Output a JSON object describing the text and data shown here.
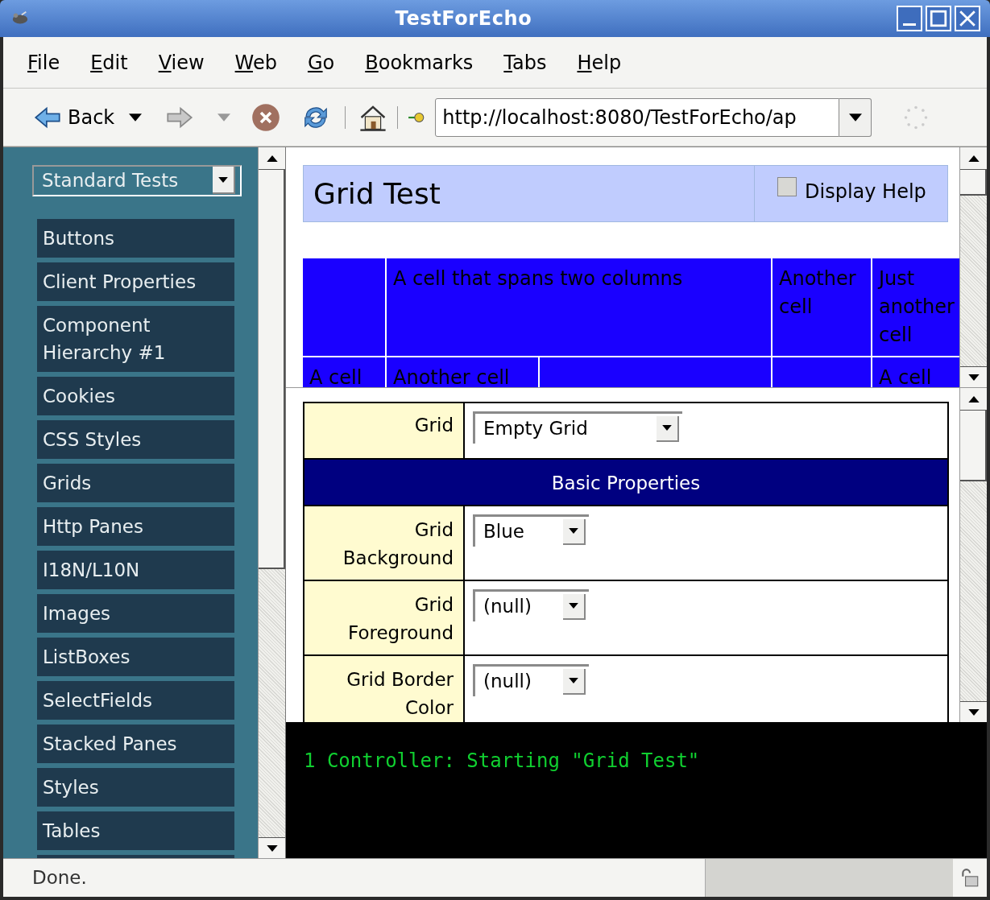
{
  "window": {
    "title": "TestForEcho"
  },
  "menu_bar": [
    "File",
    "Edit",
    "View",
    "Web",
    "Go",
    "Bookmarks",
    "Tabs",
    "Help"
  ],
  "toolbar": {
    "back_label": "Back",
    "url": "http://localhost:8080/TestForEcho/ap"
  },
  "sidebar": {
    "selector": "Standard Tests",
    "items": [
      "Buttons",
      "Client Properties",
      "Component Hierarchy #1",
      "Cookies",
      "CSS Styles",
      "Grids",
      "Http Panes",
      "I18N/L10N",
      "Images",
      "ListBoxes",
      "SelectFields",
      "Stacked Panes",
      "Styles",
      "Tables"
    ]
  },
  "header": {
    "title": "Grid Test",
    "display_help": {
      "label": "Display Help",
      "checked": false
    }
  },
  "grid": {
    "rows": [
      [
        {
          "kind": "single"
        },
        {
          "kind": "double",
          "text": "A cell that spans two columns"
        },
        {
          "kind": "single",
          "text": "Another cell"
        },
        {
          "kind": "single",
          "text": "Just another cell"
        }
      ],
      [
        {
          "kind": "single",
          "text": "A cell"
        },
        {
          "kind": "single",
          "text": "Another cell"
        },
        {
          "kind": "single"
        },
        {
          "kind": "single"
        },
        {
          "kind": "single",
          "text": "A cell"
        }
      ]
    ]
  },
  "properties": {
    "grid": {
      "label": "Grid",
      "value": "Empty Grid"
    },
    "section": "Basic Properties",
    "rows": [
      {
        "label": "Grid Background",
        "value": "Blue"
      },
      {
        "label": "Grid Foreground",
        "value": "(null)"
      },
      {
        "label": "Grid Border Color",
        "value": "(null)"
      }
    ]
  },
  "console": {
    "lines": [
      "1 Controller: Starting \"Grid Test\""
    ]
  },
  "status_bar": {
    "text": "Done."
  }
}
